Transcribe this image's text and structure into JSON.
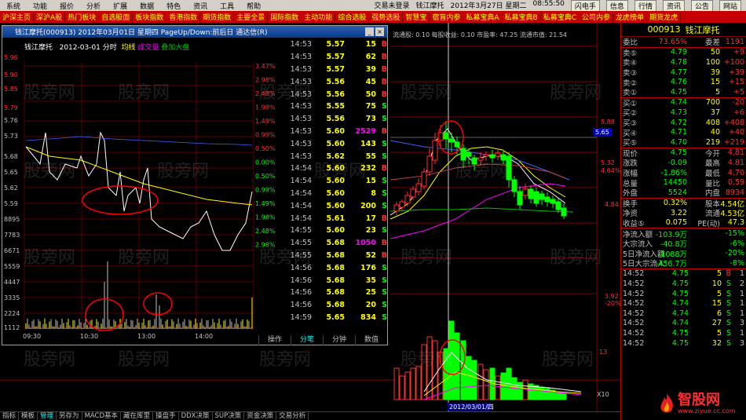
{
  "menu": {
    "items": [
      "系统",
      "功能",
      "报价",
      "分析",
      "扩展",
      "数据",
      "特色",
      "资讯",
      "工具",
      "帮助"
    ],
    "status_text": "交易未登录",
    "stock_name": "钱江摩托",
    "date": "2012年3月27日 星期二",
    "time": "08:55:50",
    "right_buttons": [
      "闪电手",
      "信息",
      "行情",
      "资讯",
      "公告",
      "网站"
    ]
  },
  "nav": {
    "items": [
      "沪深主页",
      "深沪A股",
      "热门板块",
      "自选股面",
      "板块指数",
      "香港指数",
      "期货指数",
      "主要全景",
      "国际指数",
      "主动功能",
      "综合选股",
      "强势选股",
      "智慧宝",
      "宿盲内参",
      "私募宝典A",
      "私募宝典B",
      "私募宝典C",
      "公司内参",
      "龙虎榜单",
      "期货龙虎"
    ]
  },
  "popup": {
    "title": "钱江摩托(000913) 2012年03月01日 星期四 PageUp/Down:前后日 通达信(R)",
    "header_left": "钱江摩托",
    "header_date": "2012-03-01 分时",
    "legend": [
      "均线",
      "成交量",
      "叠加大盘"
    ],
    "price_ticks": [
      "5.96",
      "5.90",
      "5.85",
      "5.79",
      "5.76",
      "5.73",
      "5.68",
      "5.65",
      "5.62",
      "5.59",
      "8895",
      "7783",
      "6671",
      "5559",
      "4447",
      "3335",
      "2224",
      "1112"
    ],
    "pct_ticks": [
      "3.47%",
      "2.98%",
      "2.48%",
      "1.98%",
      "1.49%",
      "0.99%",
      "0.50%",
      "0.00%",
      "0.50%",
      "0.99%",
      "1.49%",
      "1.98%",
      "2.48%",
      "2.98%"
    ],
    "time_ticks": [
      "09:30",
      "10:30",
      "13:00",
      "14:00"
    ],
    "trades": [
      {
        "t": "14:53",
        "p": "5.57",
        "v": "15",
        "s": "B"
      },
      {
        "t": "14:53",
        "p": "5.57",
        "v": "62",
        "s": "B"
      },
      {
        "t": "14:53",
        "p": "5.57",
        "v": "39",
        "s": "B"
      },
      {
        "t": "14:53",
        "p": "5.56",
        "v": "45",
        "s": "B"
      },
      {
        "t": "14:53",
        "p": "5.56",
        "v": "50",
        "s": "B"
      },
      {
        "t": "14:53",
        "p": "5.55",
        "v": "75",
        "s": "S"
      },
      {
        "t": "14:53",
        "p": "5.56",
        "v": "73",
        "s": "S"
      },
      {
        "t": "14:53",
        "p": "5.60",
        "v": "2529",
        "s": "B"
      },
      {
        "t": "14:53",
        "p": "5.60",
        "v": "143",
        "s": "S"
      },
      {
        "t": "14:53",
        "p": "5.62",
        "v": "55",
        "s": "S"
      },
      {
        "t": "14:54",
        "p": "5.60",
        "v": "232",
        "s": "B"
      },
      {
        "t": "14:54",
        "p": "5.60",
        "v": "15",
        "s": "S"
      },
      {
        "t": "14:54",
        "p": "5.60",
        "v": "8",
        "s": "S"
      },
      {
        "t": "14:54",
        "p": "5.60",
        "v": "200",
        "s": "S"
      },
      {
        "t": "14:54",
        "p": "5.61",
        "v": "17",
        "s": "B"
      },
      {
        "t": "14:55",
        "p": "5.60",
        "v": "23",
        "s": "S"
      },
      {
        "t": "14:55",
        "p": "5.68",
        "v": "1050",
        "s": "B"
      },
      {
        "t": "14:55",
        "p": "5.68",
        "v": "52",
        "s": "B"
      },
      {
        "t": "14:56",
        "p": "5.68",
        "v": "176",
        "s": "S"
      },
      {
        "t": "14:56",
        "p": "5.68",
        "v": "35",
        "s": "S"
      },
      {
        "t": "14:56",
        "p": "5.68",
        "v": "25",
        "s": "S"
      },
      {
        "t": "14:56",
        "p": "5.68",
        "v": "20",
        "s": "S"
      },
      {
        "t": "14:59",
        "p": "5.65",
        "v": "834",
        "s": "S"
      }
    ],
    "tabs": [
      "操作",
      "分笔",
      "分钟",
      "数值"
    ]
  },
  "kline": {
    "info": "流通股: 0.10 每股收益: 0.10 市盈率: 47.25 流通市值: 21.54",
    "date_label": "2012/03/01/四",
    "ticks": [
      "5.88",
      "5.65",
      "5.32",
      "4.84",
      "3.92",
      "13",
      "X10"
    ],
    "pct": [
      "4.64%",
      "-20%"
    ]
  },
  "right": {
    "code": "000913",
    "name": "钱江摩托",
    "summary": [
      {
        "a": "委比",
        "b": "73.65%",
        "c": "委差",
        "d": "1191"
      }
    ],
    "sells": [
      {
        "a": "卖⑤",
        "b": "4.79",
        "c": "50",
        "d": "+9"
      },
      {
        "a": "卖④",
        "b": "4.78",
        "c": "100",
        "d": "+100"
      },
      {
        "a": "卖③",
        "b": "4.77",
        "c": "39",
        "d": "+39"
      },
      {
        "a": "卖②",
        "b": "4.76",
        "c": "15",
        "d": "+15"
      },
      {
        "a": "卖①",
        "b": "4.75",
        "c": "5",
        "d": "+5"
      }
    ],
    "buys": [
      {
        "a": "买①",
        "b": "4.74",
        "c": "700",
        "d": "-20"
      },
      {
        "a": "买②",
        "b": "4.73",
        "c": "37",
        "d": "+6"
      },
      {
        "a": "买③",
        "b": "4.72",
        "c": "408",
        "d": "+408"
      },
      {
        "a": "买④",
        "b": "4.71",
        "c": "40",
        "d": "+40"
      },
      {
        "a": "买⑤",
        "b": "4.70",
        "c": "219",
        "d": "+219"
      }
    ],
    "stats": [
      {
        "a": "现价",
        "b": "4.75",
        "c": "今开",
        "d": "4.81"
      },
      {
        "a": "涨跌",
        "b": "-0.09",
        "c": "最高",
        "d": "4.81"
      },
      {
        "a": "涨幅",
        "b": "-1.86%",
        "c": "最低",
        "d": "4.70"
      },
      {
        "a": "总量",
        "b": "14450",
        "c": "量比",
        "d": "0.59"
      },
      {
        "a": "外盘",
        "b": "5524",
        "c": "内盘",
        "d": "8934"
      }
    ],
    "fund": [
      {
        "a": "换手",
        "b": "0.32%",
        "c": "股本",
        "d": "4.54亿"
      },
      {
        "a": "净资",
        "b": "3.22",
        "c": "流通",
        "d": "4.53亿"
      },
      {
        "a": "收益⑤",
        "b": "0.075",
        "c": "PE(动)",
        "d": "47.3"
      }
    ],
    "flow": [
      {
        "a": "净流入额",
        "b": "-103.9万",
        "d": "-15%"
      },
      {
        "a": "大宗流入",
        "b": "-40.8万",
        "d": "-6%"
      },
      {
        "a": "5日净流入额",
        "b": "-1088万",
        "d": "-20%"
      },
      {
        "a": "5日大宗流入",
        "b": "-456.7万",
        "d": "-8%"
      }
    ],
    "ticks": [
      {
        "t": "14:52",
        "p": "4.75",
        "v": "5",
        "s": "B",
        "n": "1"
      },
      {
        "t": "14:52",
        "p": "4.75",
        "v": "10",
        "s": "S",
        "n": "2"
      },
      {
        "t": "14:52",
        "p": "4.75",
        "v": "5",
        "s": "S",
        "n": "1"
      },
      {
        "t": "14:52",
        "p": "4.74",
        "v": "15",
        "s": "S",
        "n": "1"
      },
      {
        "t": "14:52",
        "p": "4.74",
        "v": "6",
        "s": "S",
        "n": "1"
      },
      {
        "t": "14:52",
        "p": "4.74",
        "v": "27",
        "s": "S",
        "n": "3"
      },
      {
        "t": "14:52",
        "p": "4.75",
        "v": "5",
        "s": "S",
        "n": "1"
      },
      {
        "t": "14:52",
        "p": "4.75",
        "v": "32",
        "s": "S",
        "n": "3"
      }
    ]
  },
  "bottom": {
    "items": [
      "指标",
      "模板",
      "管理",
      "另存为",
      "MACD基本",
      "藏在库里",
      "操盘手",
      "DDX决策",
      "SUP决策",
      "资金决策",
      "交易分析"
    ]
  },
  "watermark": "股旁网",
  "logo": {
    "title": "智股网",
    "site": "www.ziyue.cc.com"
  }
}
